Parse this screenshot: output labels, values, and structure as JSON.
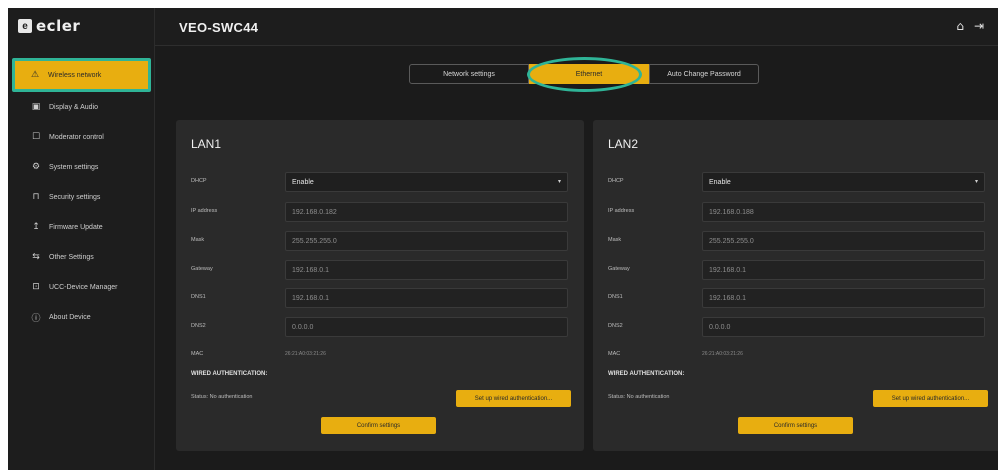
{
  "brand": {
    "mark": "e",
    "name": "ecler"
  },
  "header": {
    "device_name": "VEO-SWC44",
    "home_icon": "home-icon",
    "logout_icon": "logout-icon"
  },
  "sidebar": {
    "items": [
      {
        "label": "Wireless network",
        "icon": "wifi-icon",
        "glyph": "⚠",
        "active": true
      },
      {
        "label": "Display & Audio",
        "icon": "display-icon",
        "glyph": "▣"
      },
      {
        "label": "Moderator control",
        "icon": "moderator-icon",
        "glyph": "☐"
      },
      {
        "label": "System settings",
        "icon": "gear-icon",
        "glyph": "⚙"
      },
      {
        "label": "Security settings",
        "icon": "lock-icon",
        "glyph": "⊓"
      },
      {
        "label": "Firmware Update",
        "icon": "update-icon",
        "glyph": "↥"
      },
      {
        "label": "Other Settings",
        "icon": "sliders-icon",
        "glyph": "⇆"
      },
      {
        "label": "UCC-Device Manager",
        "icon": "device-manager-icon",
        "glyph": "⊡"
      },
      {
        "label": "About Device",
        "icon": "info-icon",
        "glyph": "ⓘ"
      }
    ]
  },
  "tabs": [
    {
      "label": "Network settings",
      "active": false
    },
    {
      "label": "Ethernet",
      "active": true
    },
    {
      "label": "Auto Change Password",
      "active": false
    }
  ],
  "lan1": {
    "title": "LAN1",
    "dhcp_label": "DHCP",
    "dhcp_value": "Enable",
    "ip_label": "IP address",
    "ip_value": "192.168.0.182",
    "mask_label": "Mask",
    "mask_value": "255.255.255.0",
    "gateway_label": "Gateway",
    "gateway_value": "192.168.0.1",
    "dns1_label": "DNS1",
    "dns1_value": "192.168.0.1",
    "dns2_label": "DNS2",
    "dns2_value": "0.0.0.0",
    "mac_label": "MAC",
    "mac_value": "26:21:A0:03:21:26",
    "wired_title": "WIRED AUTHENTICATION:",
    "status": "Status: No authentication",
    "setup_button": "Set up wired authentication...",
    "confirm_button": "Confirm settings"
  },
  "lan2": {
    "title": "LAN2",
    "dhcp_label": "DHCP",
    "dhcp_value": "Enable",
    "ip_label": "IP address",
    "ip_value": "192.168.0.188",
    "mask_label": "Mask",
    "mask_value": "255.255.255.0",
    "gateway_label": "Gateway",
    "gateway_value": "192.168.0.1",
    "dns1_label": "DNS1",
    "dns1_value": "192.168.0.1",
    "dns2_label": "DNS2",
    "dns2_value": "0.0.0.0",
    "mac_label": "MAC",
    "mac_value": "26:21:A0:03:21:26",
    "wired_title": "WIRED AUTHENTICATION:",
    "status": "Status: No authentication",
    "setup_button": "Set up wired authentication...",
    "confirm_button": "Confirm settings"
  },
  "colors": {
    "accent": "#e8ae10",
    "highlight": "#2fb497",
    "background": "#1b1b1b",
    "panel": "#2a2a2a"
  }
}
